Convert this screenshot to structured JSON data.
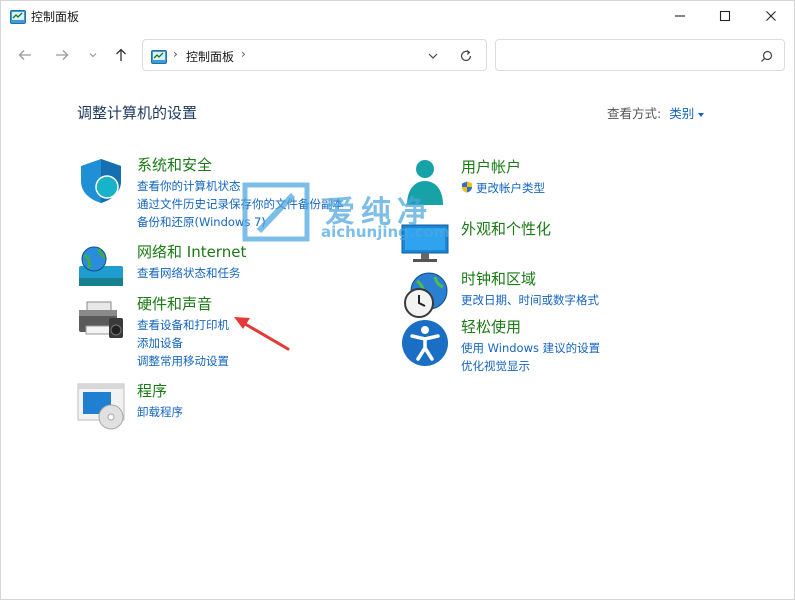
{
  "window": {
    "title": "控制面板",
    "controls": {
      "minimize": "minimize-icon",
      "maximize": "maximize-icon",
      "close": "close-icon"
    }
  },
  "address_bar": {
    "separator": "›",
    "breadcrumb": "控制面板",
    "search_placeholder": ""
  },
  "header": {
    "title": "调整计算机的设置",
    "view_by_label": "查看方式:",
    "view_by_value": "类别"
  },
  "categories": [
    {
      "title": "系统和安全",
      "icon": "shield-icon",
      "links": [
        "查看你的计算机状态",
        "通过文件历史记录保存你的文件备份副本",
        "备份和还原(Windows 7)"
      ]
    },
    {
      "title": "网络和 Internet",
      "icon": "network-globe-icon",
      "links": [
        "查看网络状态和任务"
      ]
    },
    {
      "title": "硬件和声音",
      "icon": "printer-icon",
      "links": [
        "查看设备和打印机",
        "添加设备",
        "调整常用移动设置"
      ]
    },
    {
      "title": "程序",
      "icon": "programs-icon",
      "links": [
        "卸载程序"
      ]
    },
    {
      "title": "用户帐户",
      "icon": "user-accounts-icon",
      "links": [
        "更改帐户类型"
      ]
    },
    {
      "title": "外观和个性化",
      "icon": "monitor-icon",
      "links": []
    },
    {
      "title": "时钟和区域",
      "icon": "clock-globe-icon",
      "links": [
        "更改日期、时间或数字格式"
      ]
    },
    {
      "title": "轻松使用",
      "icon": "accessibility-icon",
      "links": [
        "使用 Windows 建议的设置",
        "优化视觉显示"
      ]
    }
  ],
  "watermark": {
    "text_cn": "爱纯净",
    "text_en": "aichunjing.com"
  },
  "colors": {
    "category_title": "#1a7a14",
    "link": "#1565c0",
    "page_title": "#1e3a5f",
    "annotation_arrow": "#e53935"
  }
}
